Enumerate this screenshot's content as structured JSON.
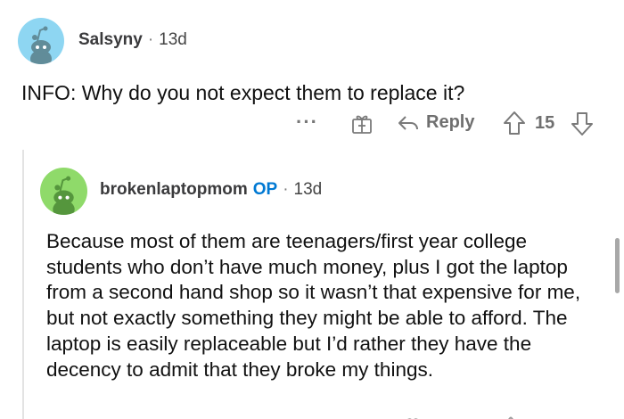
{
  "comment": {
    "author": "Salsyny",
    "separator": "·",
    "time": "13d",
    "text": "INFO: Why do you not expect them to replace it?",
    "actions": {
      "more": "···",
      "reply_label": "Reply",
      "score": "15"
    }
  },
  "reply": {
    "author": "brokenlaptopmom",
    "op_badge": "OP",
    "separator": "·",
    "time": "13d",
    "text": "Because most of them are teenagers/first year college students who don’t have much money, plus I got the laptop from a second hand shop so it wasn’t that expensive for me, but not exactly something they might be able to afford. The laptop is easily replaceable but I’d rather they have the decency to admit that they broke my things."
  },
  "colors": {
    "avatar1_bg": "#8ed6f2",
    "avatar2_bg": "#8fda6a",
    "op_color": "#0079d3",
    "icon_gray": "#7a7a7a"
  },
  "icons": [
    "snoo-avatar-icon",
    "more-options-icon",
    "award-icon",
    "reply-arrow-icon",
    "upvote-icon",
    "downvote-icon"
  ]
}
